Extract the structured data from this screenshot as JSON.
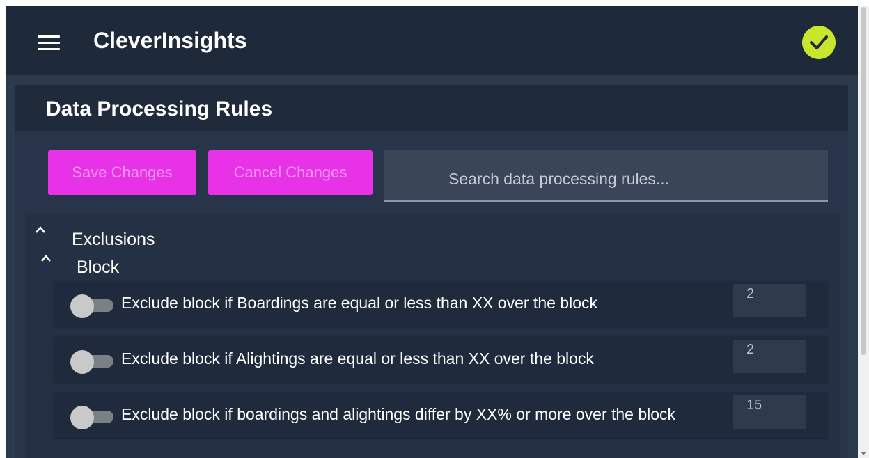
{
  "app": {
    "title": "CleverInsights",
    "status_icon": "check-circle-icon",
    "accent_color": "#e832e8",
    "status_color": "#c8e62d"
  },
  "card": {
    "title": "Data Processing Rules",
    "save_label": "Save Changes",
    "cancel_label": "Cancel Changes",
    "search_placeholder": "Search data processing rules..."
  },
  "groups": {
    "exclusions": {
      "label": "Exclusions",
      "expanded": true
    },
    "block": {
      "label": "Block",
      "expanded": true
    }
  },
  "rules": [
    {
      "label": "Exclude block if Boardings are equal or less than XX over the block",
      "value": "2",
      "enabled": false
    },
    {
      "label": "Exclude block if Alightings are equal or less than XX over the block",
      "value": "2",
      "enabled": false
    },
    {
      "label": "Exclude block if boardings and alightings differ by XX% or more over the block",
      "value": "15",
      "enabled": false
    }
  ]
}
